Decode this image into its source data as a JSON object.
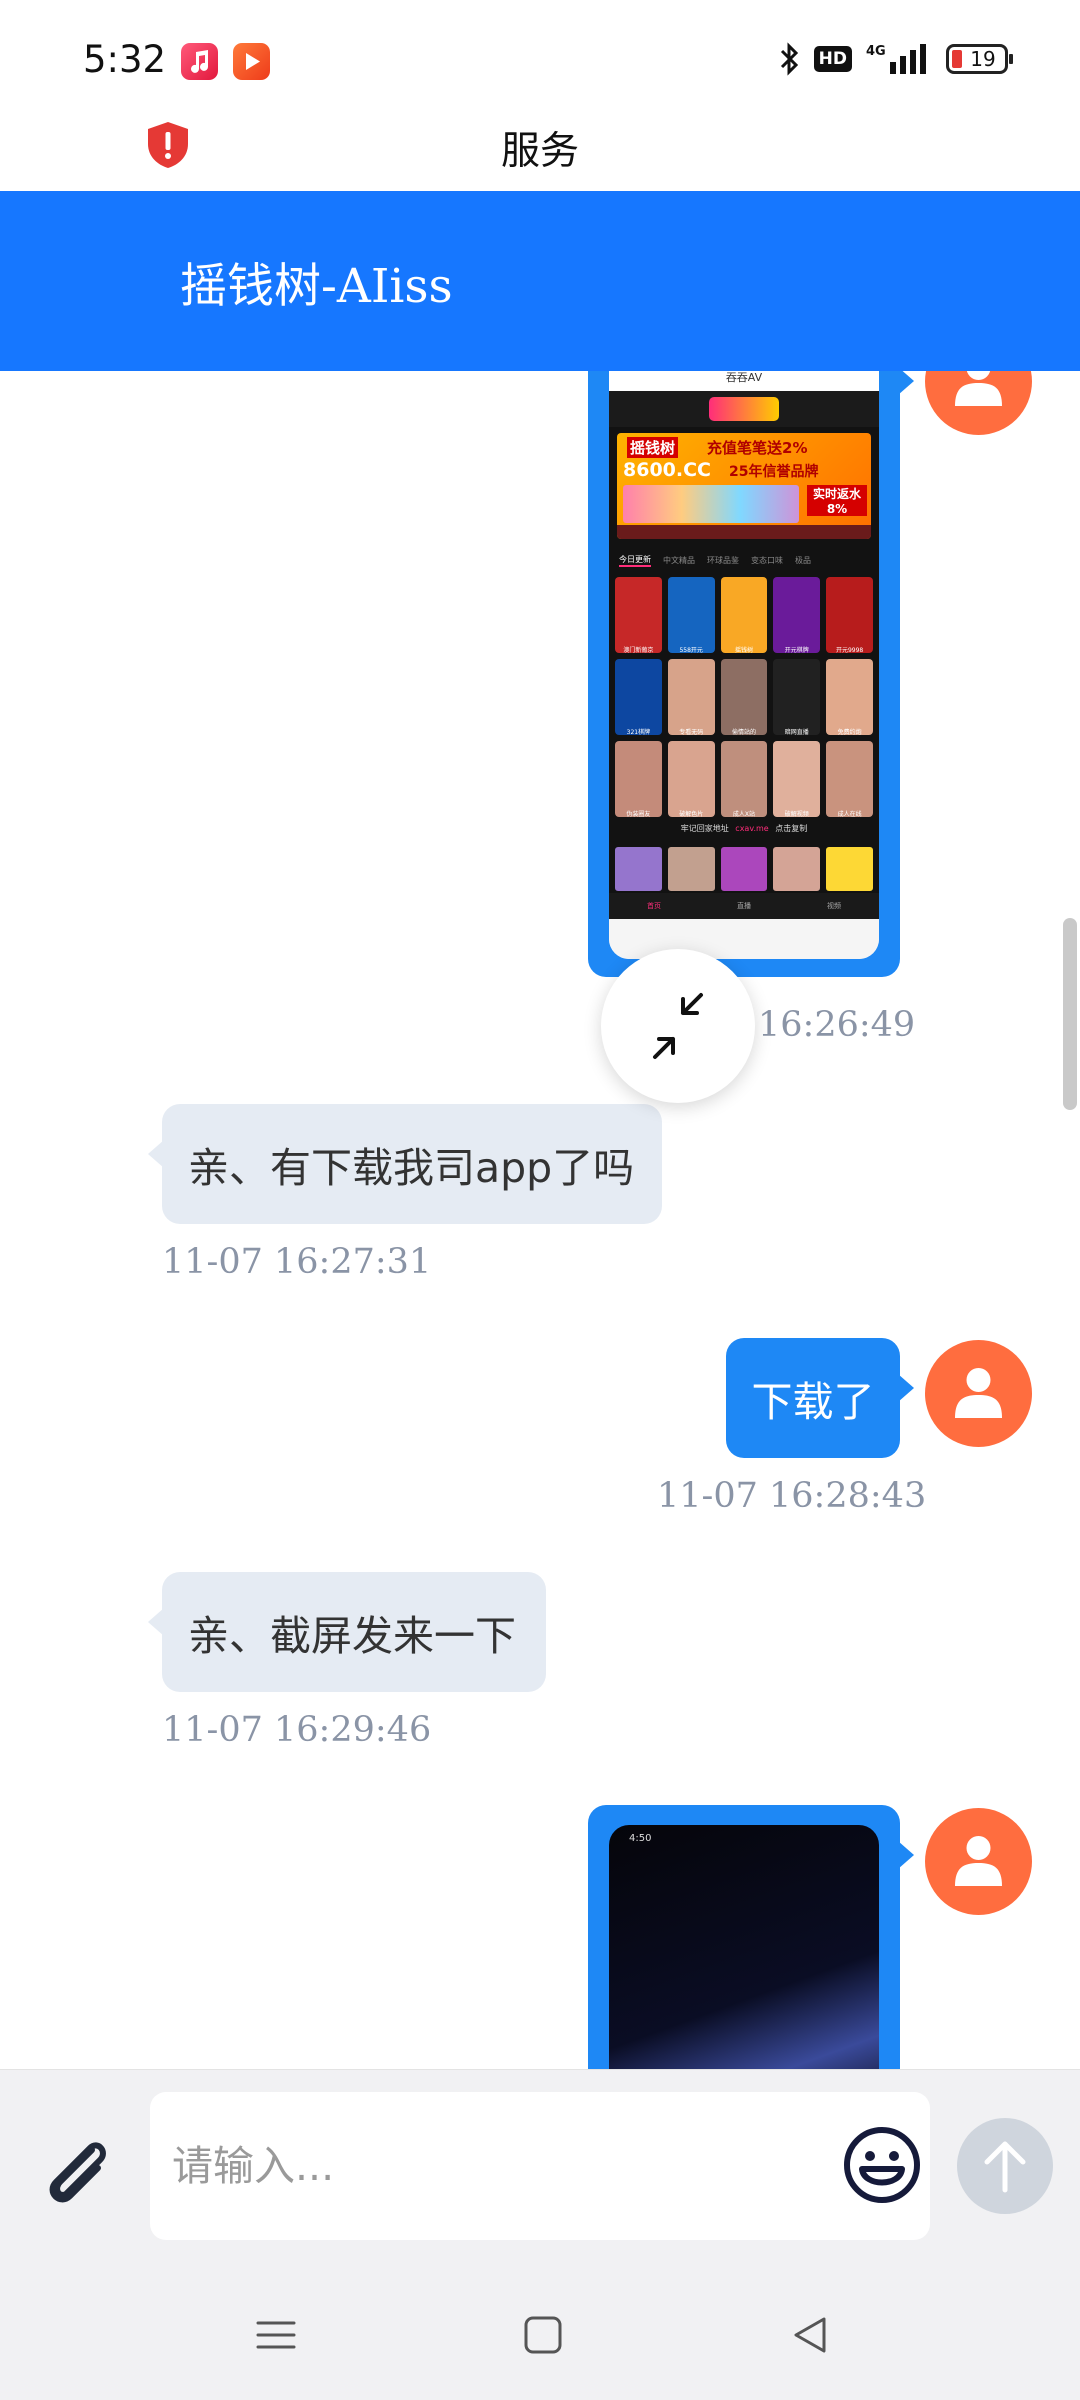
{
  "status_bar": {
    "time": "5:32",
    "battery": "19",
    "network": "4G",
    "hd_label": "HD",
    "icons": [
      "music-app-icon",
      "video-app-icon",
      "bluetooth-icon",
      "hd-icon",
      "signal-icon",
      "battery-icon"
    ]
  },
  "browser": {
    "title": "服务",
    "security_icon": "shield-warning-icon"
  },
  "header": {
    "title": "摇钱树-AIiss",
    "color": "#1677ff"
  },
  "messages": [
    {
      "id": "m1",
      "side": "outgoing",
      "type": "image",
      "image_label": "screenshot of app home page",
      "timestamp": "16:26:49"
    },
    {
      "id": "m2",
      "side": "incoming",
      "type": "text",
      "text": "亲、有下载我司app了吗",
      "timestamp": "11-07 16:27:31"
    },
    {
      "id": "m3",
      "side": "outgoing",
      "type": "text",
      "text": "下载了",
      "timestamp": "11-07 16:28:43"
    },
    {
      "id": "m4",
      "side": "incoming",
      "type": "text",
      "text": "亲、截屏发来一下",
      "timestamp": "11-07 16:29:46"
    },
    {
      "id": "m5",
      "side": "outgoing",
      "type": "image",
      "image_label": "screenshot of phone lock screen"
    }
  ],
  "screenshot_1": {
    "topbar_title": "吞吞AV",
    "banner_line1": "摇钱树",
    "banner_line2": "充值笔笔送2%",
    "banner_line3": "8600.CC",
    "banner_line4": "25年信誉品牌",
    "banner_line5": "实时返水 8%",
    "tabs": [
      "今日更新",
      "中文精品",
      "环球品鉴",
      "变态口味",
      "极品"
    ],
    "grid_labels": [
      "澳门新葡京",
      "558开元",
      "摇钱树",
      "开元棋牌",
      "开元9998",
      "321棋牌",
      "专看无码",
      "偷情站的",
      "暗网直播",
      "免费约炮",
      "伪装圈友",
      "破解色片",
      "成人X站",
      "破解视频",
      "成人在线"
    ],
    "notice_text": "牢记回家地址",
    "notice_url": "cxav.me",
    "notice_action": "点击复制",
    "bottom_nav": [
      "首页",
      "直播",
      "视频"
    ]
  },
  "screenshot_2": {
    "time": "4:50"
  },
  "input": {
    "placeholder": "请输入..."
  },
  "nav": {
    "items": [
      "menu-icon",
      "home-icon",
      "back-icon"
    ]
  },
  "colors": {
    "outgoing_bubble": "#1e88f5",
    "incoming_bubble": "#e5ebf3",
    "avatar": "#ff6d3f",
    "timestamp": "#8a94a6"
  }
}
